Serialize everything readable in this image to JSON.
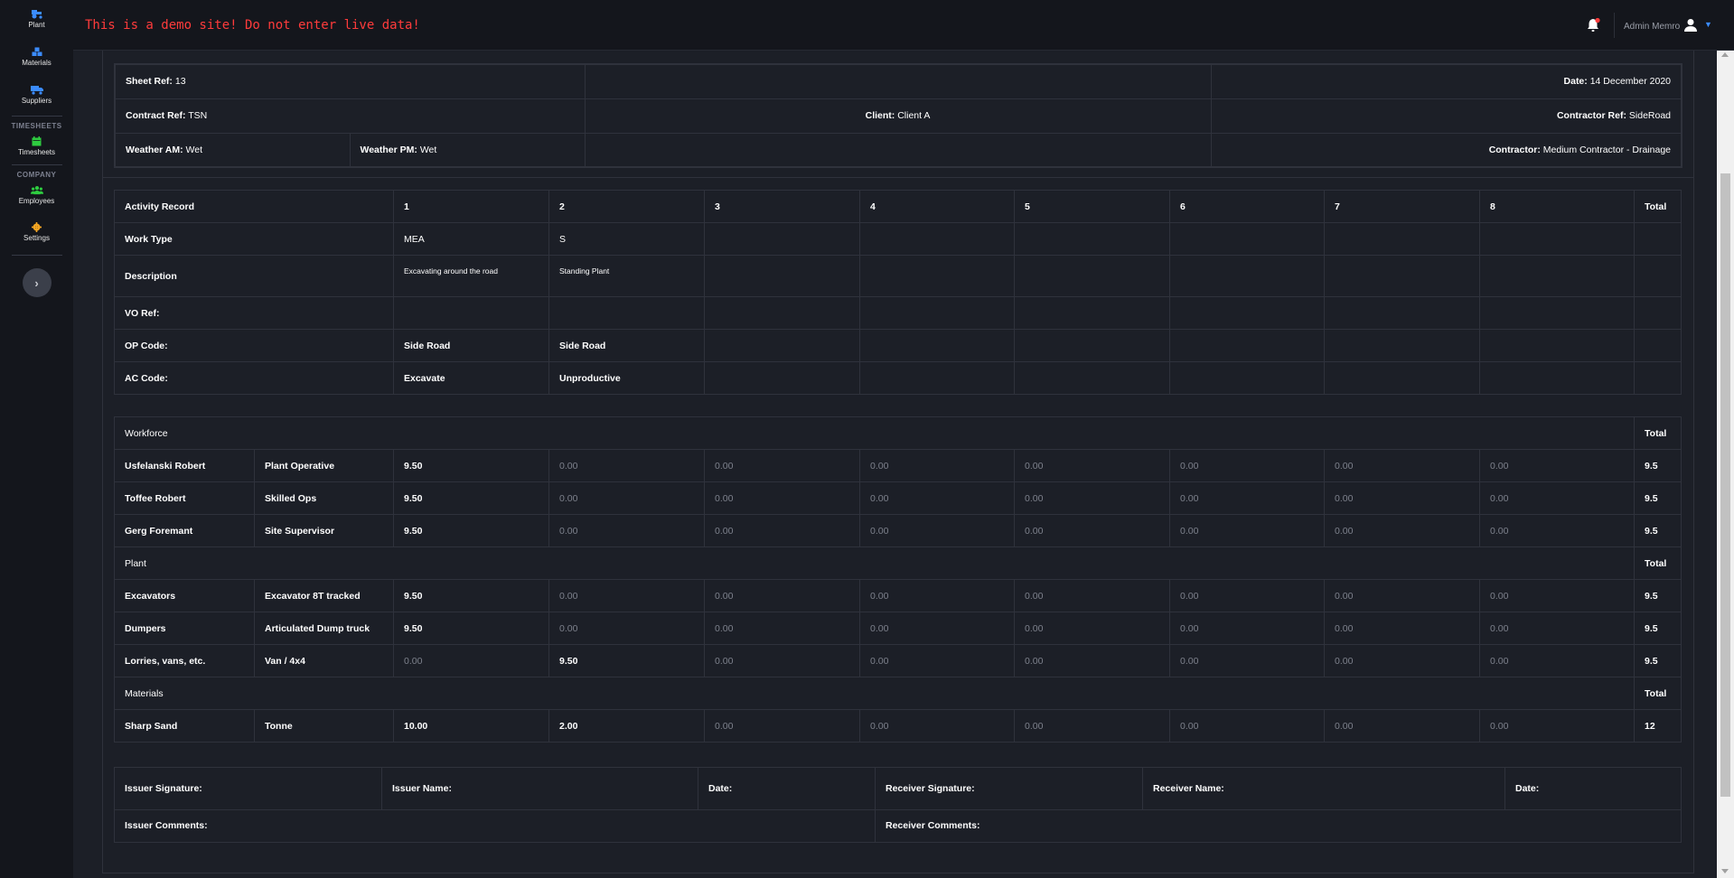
{
  "sidebar": {
    "items_top": [
      {
        "label": "Plant",
        "icon": "tractor-icon",
        "color": "#3b8cff"
      },
      {
        "label": "Materials",
        "icon": "cubes-icon",
        "color": "#3b8cff"
      },
      {
        "label": "Suppliers",
        "icon": "truck-icon",
        "color": "#3b8cff"
      }
    ],
    "section_timesheets": "TIMESHEETS",
    "timesheets_label": "Timesheets",
    "section_company": "COMPANY",
    "employees_label": "Employees",
    "settings_label": "Settings",
    "colors": {
      "timesheets": "#2ecc40",
      "employees": "#2ecc40",
      "settings": "#f5a623"
    }
  },
  "topbar": {
    "warning": "This is a demo site! Do not enter live data!",
    "user_name": "Admin Memro",
    "notification_dot_color": "#ff3b3b"
  },
  "header": {
    "sheet_ref_label": "Sheet Ref:",
    "sheet_ref": "13",
    "date_label": "Date:",
    "date": "14 December 2020",
    "contract_ref_label": "Contract Ref:",
    "contract_ref": "TSN",
    "client_label": "Client:",
    "client": "Client A",
    "contractor_ref_label": "Contractor Ref:",
    "contractor_ref": "SideRoad",
    "weather_am_label": "Weather AM:",
    "weather_am": "Wet",
    "weather_pm_label": "Weather PM:",
    "weather_pm": "Wet",
    "contractor_label": "Contractor:",
    "contractor": "Medium Contractor - Drainage"
  },
  "activity": {
    "title": "Activity Record",
    "columns": [
      "1",
      "2",
      "3",
      "4",
      "5",
      "6",
      "7",
      "8"
    ],
    "total_label": "Total",
    "rows": {
      "work_type_label": "Work Type",
      "work_type": [
        "MEA",
        "S"
      ],
      "description_label": "Description",
      "description": [
        "Excavating around the road",
        "Standing Plant"
      ],
      "vo_ref_label": "VO Ref:",
      "op_code_label": "OP Code:",
      "op_code": [
        "Side Road",
        "Side Road"
      ],
      "ac_code_label": "AC Code:",
      "ac_code": [
        "Excavate",
        "Unproductive"
      ]
    }
  },
  "resources": {
    "total_label": "Total",
    "workforce_label": "Workforce",
    "workforce": [
      {
        "name": "Usfelanski Robert",
        "role": "Plant Operative",
        "values": [
          "9.50",
          "0.00",
          "0.00",
          "0.00",
          "0.00",
          "0.00",
          "0.00",
          "0.00"
        ],
        "total": "9.5"
      },
      {
        "name": "Toffee Robert",
        "role": "Skilled Ops",
        "values": [
          "9.50",
          "0.00",
          "0.00",
          "0.00",
          "0.00",
          "0.00",
          "0.00",
          "0.00"
        ],
        "total": "9.5"
      },
      {
        "name": "Gerg Foremant",
        "role": "Site Supervisor",
        "values": [
          "9.50",
          "0.00",
          "0.00",
          "0.00",
          "0.00",
          "0.00",
          "0.00",
          "0.00"
        ],
        "total": "9.5"
      }
    ],
    "plant_label": "Plant",
    "plant": [
      {
        "name": "Excavators",
        "role": "Excavator 8T tracked",
        "values": [
          "9.50",
          "0.00",
          "0.00",
          "0.00",
          "0.00",
          "0.00",
          "0.00",
          "0.00"
        ],
        "total": "9.5"
      },
      {
        "name": "Dumpers",
        "role": "Articulated Dump truck",
        "values": [
          "9.50",
          "0.00",
          "0.00",
          "0.00",
          "0.00",
          "0.00",
          "0.00",
          "0.00"
        ],
        "total": "9.5"
      },
      {
        "name": "Lorries, vans, etc.",
        "role": "Van / 4x4",
        "values": [
          "0.00",
          "9.50",
          "0.00",
          "0.00",
          "0.00",
          "0.00",
          "0.00",
          "0.00"
        ],
        "total": "9.5"
      }
    ],
    "materials_label": "Materials",
    "materials": [
      {
        "name": "Sharp Sand",
        "role": "Tonne",
        "values": [
          "10.00",
          "2.00",
          "0.00",
          "0.00",
          "0.00",
          "0.00",
          "0.00",
          "0.00"
        ],
        "total": "12"
      }
    ]
  },
  "signoff": {
    "issuer_signature": "Issuer Signature:",
    "issuer_name": "Issuer Name:",
    "issuer_date": "Date:",
    "receiver_signature": "Receiver Signature:",
    "receiver_name": "Receiver Name:",
    "receiver_date": "Date:",
    "issuer_comments": "Issuer Comments:",
    "receiver_comments": "Receiver Comments:"
  }
}
